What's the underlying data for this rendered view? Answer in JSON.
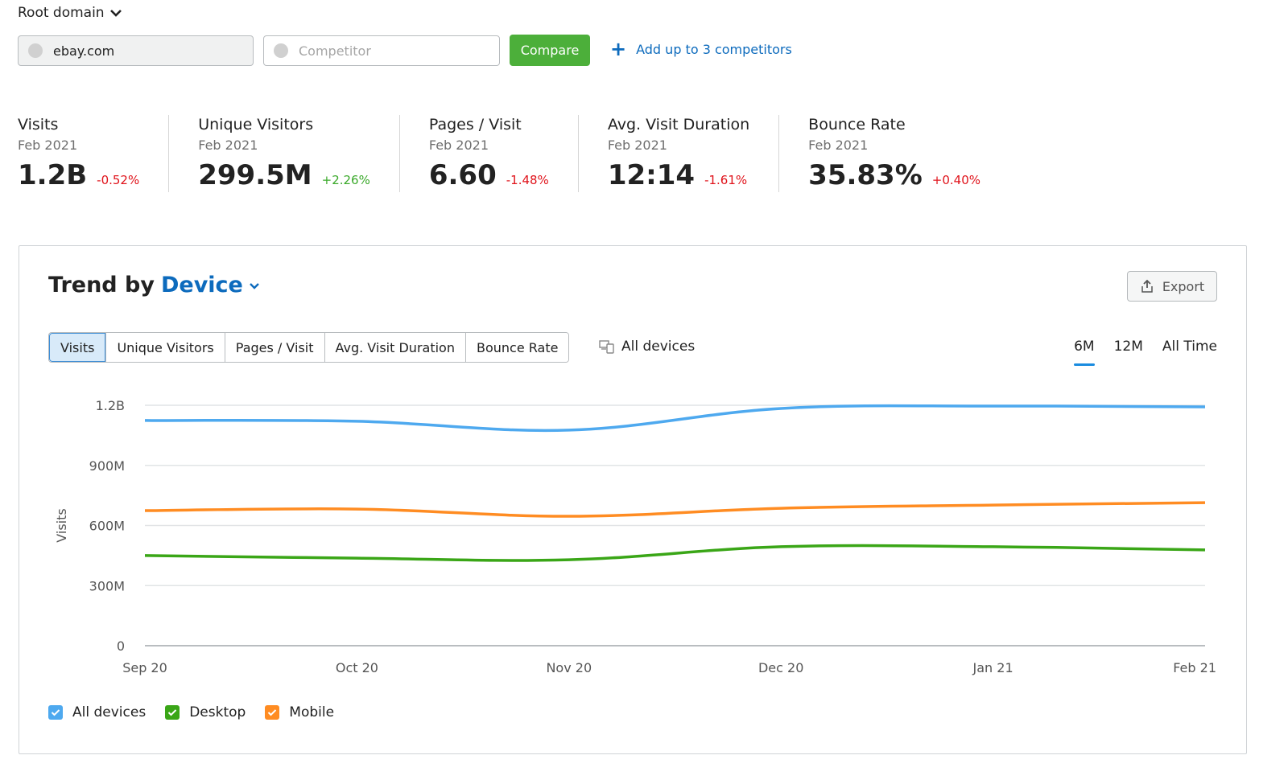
{
  "header": {
    "root_domain_label": "Root domain",
    "domain_value": "ebay.com",
    "competitor_placeholder": "Competitor",
    "compare_label": "Compare",
    "add_competitors_label": "Add up to 3 competitors"
  },
  "metrics": [
    {
      "title": "Visits",
      "date": "Feb 2021",
      "value": "1.2B",
      "delta": "-0.52%",
      "trend": "negative"
    },
    {
      "title": "Unique Visitors",
      "date": "Feb 2021",
      "value": "299.5M",
      "delta": "+2.26%",
      "trend": "positive"
    },
    {
      "title": "Pages / Visit",
      "date": "Feb 2021",
      "value": "6.60",
      "delta": "-1.48%",
      "trend": "negative"
    },
    {
      "title": "Avg. Visit Duration",
      "date": "Feb 2021",
      "value": "12:14",
      "delta": "-1.61%",
      "trend": "negative"
    },
    {
      "title": "Bounce Rate",
      "date": "Feb 2021",
      "value": "35.83%",
      "delta": "+0.40%",
      "trend": "negative"
    }
  ],
  "trend_card": {
    "title_prefix": "Trend by",
    "title_dimension": "Device",
    "export_label": "Export",
    "metric_tabs": [
      "Visits",
      "Unique Visitors",
      "Pages / Visit",
      "Avg. Visit Duration",
      "Bounce Rate"
    ],
    "active_metric_tab": "Visits",
    "devices_filter_label": "All devices",
    "period_tabs": [
      "6M",
      "12M",
      "All Time"
    ],
    "active_period": "6M"
  },
  "colors": {
    "all_devices": "#4ea9ef",
    "desktop": "#3aa617",
    "mobile": "#ff8c22",
    "accent_blue": "#0d6bbd",
    "compare_green": "#4caf3a"
  },
  "chart_data": {
    "type": "line",
    "title": "Trend by Device",
    "xlabel": "",
    "ylabel": "Visits",
    "x": [
      "Sep 20",
      "Oct 20",
      "Nov 20",
      "Dec 20",
      "Jan 21",
      "Feb 21"
    ],
    "y_ticks": [
      "0",
      "300M",
      "600M",
      "900M",
      "1.2B"
    ],
    "y_tick_values": [
      0,
      300000000,
      600000000,
      900000000,
      1200000000
    ],
    "ylim": [
      0,
      1200000000
    ],
    "grid": true,
    "legend_position": "bottom-left",
    "series": [
      {
        "name": "All devices",
        "color": "#4ea9ef",
        "values": [
          1124000000,
          1120000000,
          1076000000,
          1184000000,
          1196000000,
          1192000000
        ]
      },
      {
        "name": "Mobile",
        "color": "#ff8c22",
        "values": [
          674000000,
          682000000,
          646000000,
          686000000,
          702000000,
          714000000
        ]
      },
      {
        "name": "Desktop",
        "color": "#3aa617",
        "values": [
          450000000,
          437000000,
          429000000,
          494000000,
          494000000,
          478000000
        ]
      }
    ],
    "legend": [
      {
        "name": "All devices",
        "color": "#4ea9ef",
        "checked": true
      },
      {
        "name": "Desktop",
        "color": "#3aa617",
        "checked": true
      },
      {
        "name": "Mobile",
        "color": "#ff8c22",
        "checked": true
      }
    ]
  }
}
